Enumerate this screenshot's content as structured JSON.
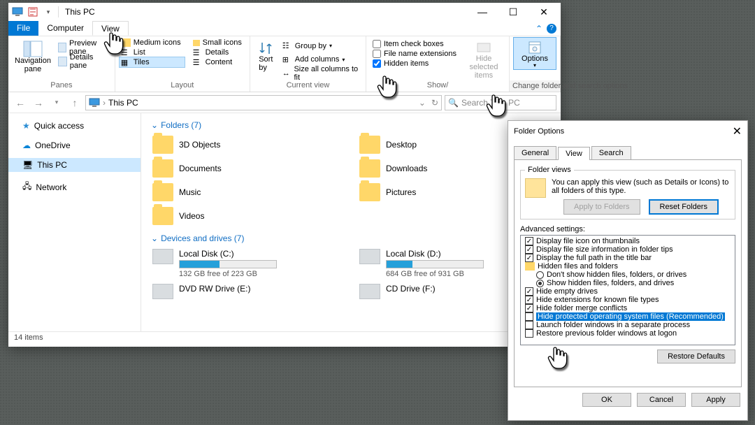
{
  "explorer": {
    "title": "This PC",
    "menu_tabs": {
      "file": "File",
      "computer": "Computer",
      "view": "View"
    },
    "ribbon": {
      "panes_cap": "Panes",
      "navpane": "Navigation\npane",
      "preview": "Preview pane",
      "details_pane": "Details pane",
      "layout_cap": "Layout",
      "layouts": {
        "medium": "Medium icons",
        "small": "Small icons",
        "list": "List",
        "details": "Details",
        "tiles": "Tiles",
        "content": "Content"
      },
      "currentview_cap": "Current view",
      "sortby": "Sort\nby",
      "groupby": "Group by",
      "addcols": "Add columns",
      "sizecols": "Size all columns to fit",
      "showhide_cap": "Show/",
      "itemcheck": "Item check boxes",
      "filext": "File name extensions",
      "hidden": "Hidden items",
      "hidesel": "Hide selected\nitems",
      "options": "Options",
      "changefolder": "Change folder and search options"
    },
    "addressbar": {
      "path": "This PC",
      "search_placeholder": "Search This PC"
    },
    "sidebar": {
      "items": [
        {
          "label": "Quick access"
        },
        {
          "label": "OneDrive"
        },
        {
          "label": "This PC"
        },
        {
          "label": "Network"
        }
      ]
    },
    "sections": {
      "folders": "Folders (7)",
      "drives": "Devices and drives (7)"
    },
    "folders": [
      {
        "name": "3D Objects"
      },
      {
        "name": "Desktop"
      },
      {
        "name": "Documents"
      },
      {
        "name": "Downloads"
      },
      {
        "name": "Music"
      },
      {
        "name": "Pictures"
      },
      {
        "name": "Videos"
      }
    ],
    "drives": [
      {
        "name": "Local Disk (C:)",
        "free": "132 GB free of 223 GB",
        "pct": 41
      },
      {
        "name": "Local Disk (D:)",
        "free": "684 GB free of 931 GB",
        "pct": 27
      },
      {
        "name": "DVD RW Drive (E:)",
        "free": "",
        "pct": null
      },
      {
        "name": "CD Drive (F:)",
        "free": "",
        "pct": null
      }
    ],
    "status": "14 items"
  },
  "dialog": {
    "title": "Folder Options",
    "tabs": {
      "general": "General",
      "view": "View",
      "search": "Search"
    },
    "folderviews": {
      "legend": "Folder views",
      "text": "You can apply this view (such as Details or Icons) to all folders of this type.",
      "apply": "Apply to Folders",
      "reset": "Reset Folders"
    },
    "advanced_label": "Advanced settings:",
    "advanced": [
      {
        "type": "check",
        "checked": true,
        "indent": 0,
        "label": "Display file icon on thumbnails"
      },
      {
        "type": "check",
        "checked": true,
        "indent": 0,
        "label": "Display file size information in folder tips"
      },
      {
        "type": "check",
        "checked": true,
        "indent": 0,
        "label": "Display the full path in the title bar"
      },
      {
        "type": "folder",
        "checked": false,
        "indent": 0,
        "label": "Hidden files and folders"
      },
      {
        "type": "radio",
        "checked": false,
        "indent": 1,
        "label": "Don't show hidden files, folders, or drives"
      },
      {
        "type": "radio",
        "checked": true,
        "indent": 1,
        "label": "Show hidden files, folders, and drives"
      },
      {
        "type": "check",
        "checked": true,
        "indent": 0,
        "label": "Hide empty drives"
      },
      {
        "type": "check",
        "checked": true,
        "indent": 0,
        "label": "Hide extensions for known file types"
      },
      {
        "type": "check",
        "checked": true,
        "indent": 0,
        "label": "Hide folder merge conflicts"
      },
      {
        "type": "check",
        "checked": false,
        "indent": 0,
        "label": "Hide protected operating system files (Recommended)",
        "highlight": true
      },
      {
        "type": "check",
        "checked": false,
        "indent": 0,
        "label": "Launch folder windows in a separate process"
      },
      {
        "type": "check",
        "checked": false,
        "indent": 0,
        "label": "Restore previous folder windows at logon"
      }
    ],
    "restore": "Restore Defaults",
    "ok": "OK",
    "cancel": "Cancel",
    "apply": "Apply"
  }
}
